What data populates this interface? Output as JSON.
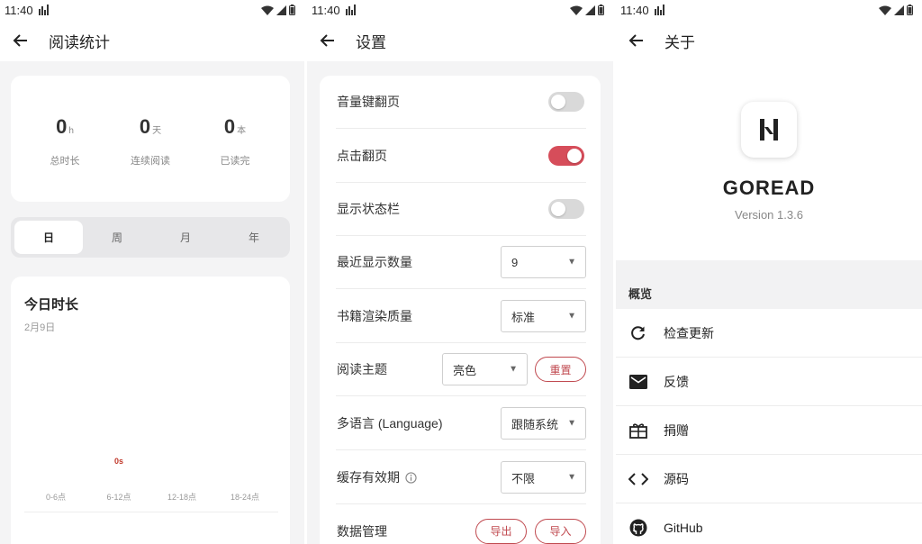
{
  "status_bar": {
    "time": "11:40"
  },
  "reading_stats": {
    "title": "阅读统计",
    "stats": [
      {
        "value": "0",
        "unit": "h",
        "label": "总时长"
      },
      {
        "value": "0",
        "unit": "天",
        "label": "连续阅读"
      },
      {
        "value": "0",
        "unit": "本",
        "label": "已读完"
      }
    ],
    "tabs": [
      "日",
      "周",
      "月",
      "年"
    ],
    "selected_tab": "日",
    "today": {
      "title": "今日时长",
      "date": "2月9日",
      "chart_data": {
        "type": "bar",
        "categories": [
          "0-6点",
          "6-12点",
          "12-18点",
          "18-24点"
        ],
        "values": [
          0,
          0,
          0,
          0
        ],
        "data_labels": [
          "",
          "0s",
          "",
          ""
        ]
      }
    }
  },
  "settings": {
    "title": "设置",
    "volume_key_page": {
      "label": "音量键翻页",
      "on": false
    },
    "tap_page": {
      "label": "点击翻页",
      "on": true
    },
    "show_statusbar": {
      "label": "显示状态栏",
      "on": false
    },
    "recent_count": {
      "label": "最近显示数量",
      "value": "9"
    },
    "render_quality": {
      "label": "书籍渲染质量",
      "value": "标准"
    },
    "theme": {
      "label": "阅读主题",
      "value": "亮色",
      "reset": "重置"
    },
    "language": {
      "label": "多语言 (Language)",
      "value": "跟随系统"
    },
    "cache_validity": {
      "label": "缓存有效期",
      "value": "不限"
    },
    "data_management": {
      "label": "数据管理",
      "export": "导出",
      "import": "导入"
    },
    "accent_color": "#d64d5a"
  },
  "about": {
    "title": "关于",
    "app_name": "GOREAD",
    "version": "Version 1.3.6",
    "section": "概览",
    "items": [
      {
        "icon": "refresh-icon",
        "label": "检查更新"
      },
      {
        "icon": "mail-icon",
        "label": "反馈"
      },
      {
        "icon": "gift-icon",
        "label": "捐赠"
      },
      {
        "icon": "code-icon",
        "label": "源码"
      },
      {
        "icon": "github-icon",
        "label": "GitHub"
      }
    ]
  }
}
